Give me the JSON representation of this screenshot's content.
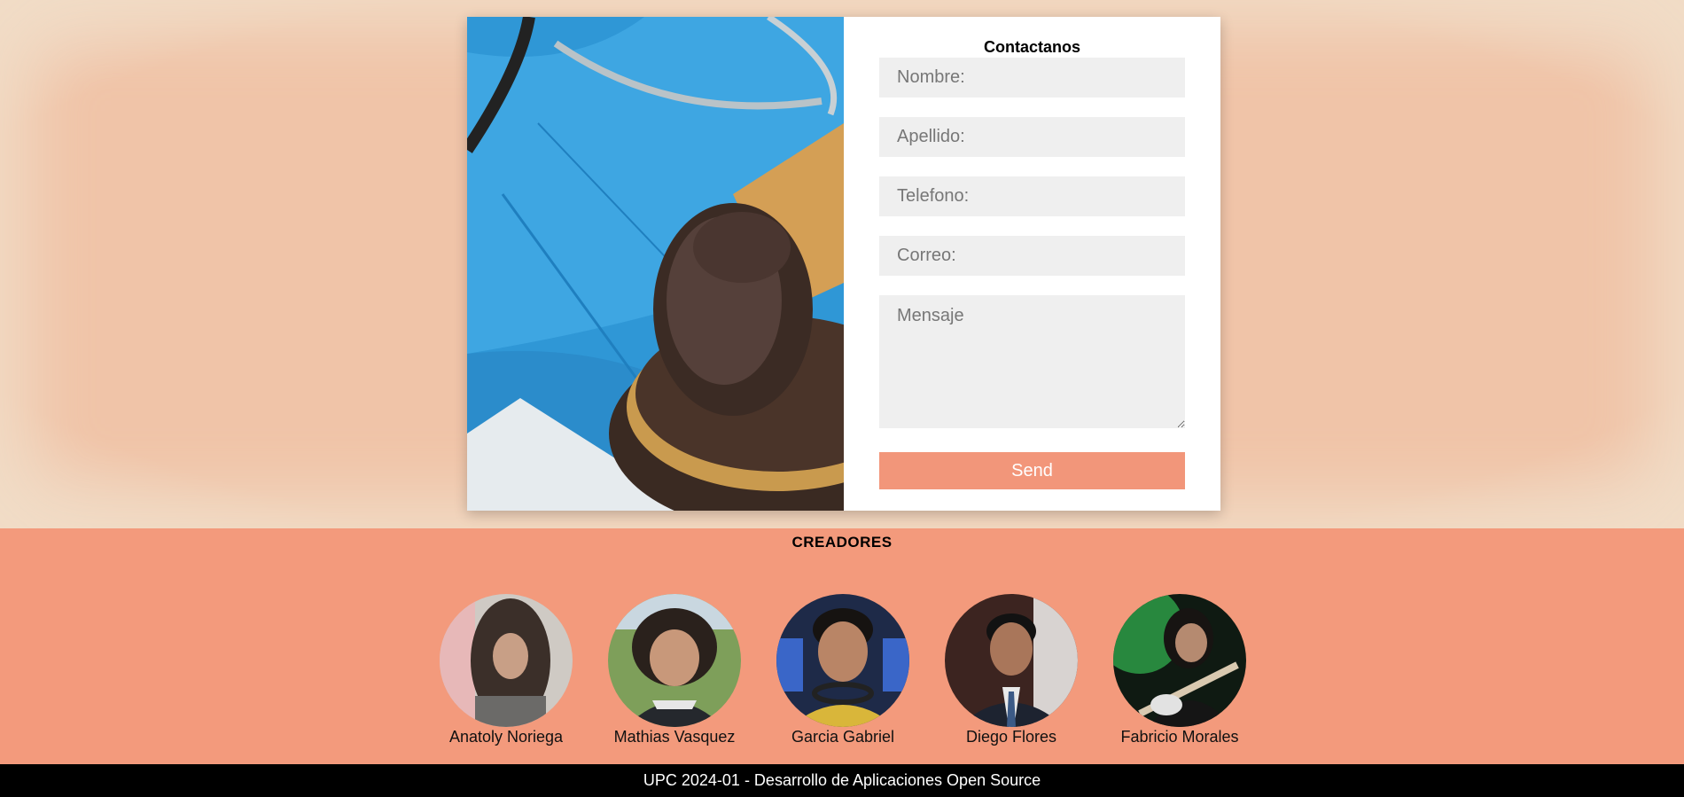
{
  "contact": {
    "title": "Contactanos",
    "fields": {
      "nombre_placeholder": "Nombre:",
      "apellido_placeholder": "Apellido:",
      "telefono_placeholder": "Telefono:",
      "correo_placeholder": "Correo:",
      "mensaje_placeholder": "Mensaje"
    },
    "send_label": "Send",
    "image": "stethoscope-and-gavel-photo"
  },
  "creators": {
    "title": "CREADORES",
    "people": [
      {
        "name": "Anatoly Noriega"
      },
      {
        "name": "Mathias Vasquez"
      },
      {
        "name": "Garcia Gabriel"
      },
      {
        "name": "Diego Flores"
      },
      {
        "name": "Fabricio Morales"
      }
    ]
  },
  "footer": {
    "text": "UPC 2024-01 - Desarrollo de Aplicaciones Open Source"
  },
  "colors": {
    "page_background": "#f0c6ab",
    "accent": "#f39a7c",
    "button": "#f2967a",
    "footer": "#000000"
  }
}
